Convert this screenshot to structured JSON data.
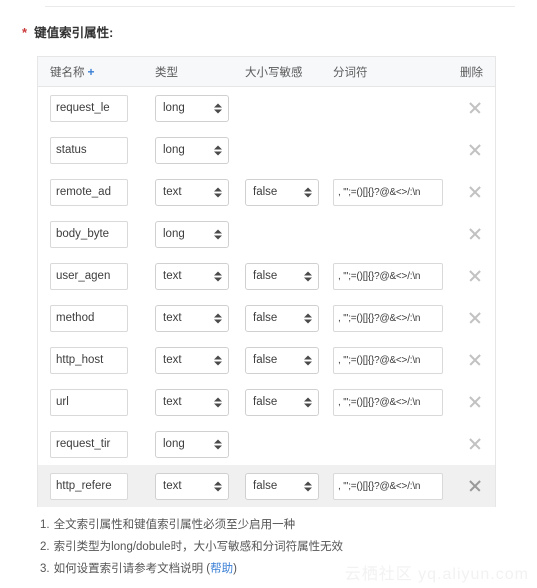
{
  "section": {
    "label": "键值索引属性:",
    "required_marker": "*"
  },
  "table": {
    "headers": {
      "key_name": "键名称",
      "add_symbol": "+",
      "type": "类型",
      "case_sensitive": "大小写敏感",
      "tokenizer": "分词符",
      "delete": "删除"
    },
    "delete_icon": "close-icon",
    "rows": [
      {
        "key": "request_le",
        "type": "long",
        "case": "",
        "tokenizer": "",
        "hovered": false
      },
      {
        "key": "status",
        "type": "long",
        "case": "",
        "tokenizer": "",
        "hovered": false
      },
      {
        "key": "remote_ad",
        "type": "text",
        "case": "false",
        "tokenizer": ", '\";=()[]{}?@&<>/:\\n",
        "hovered": false
      },
      {
        "key": "body_byte",
        "type": "long",
        "case": "",
        "tokenizer": "",
        "hovered": false
      },
      {
        "key": "user_agen",
        "type": "text",
        "case": "false",
        "tokenizer": ", '\";=()[]{}?@&<>/:\\n",
        "hovered": false
      },
      {
        "key": "method",
        "type": "text",
        "case": "false",
        "tokenizer": ", '\";=()[]{}?@&<>/:\\n",
        "hovered": false
      },
      {
        "key": "http_host",
        "type": "text",
        "case": "false",
        "tokenizer": ", '\";=()[]{}?@&<>/:\\n",
        "hovered": false
      },
      {
        "key": "url",
        "type": "text",
        "case": "false",
        "tokenizer": ", '\";=()[]{}?@&<>/:\\n",
        "hovered": false
      },
      {
        "key": "request_tir",
        "type": "long",
        "case": "",
        "tokenizer": "",
        "hovered": false
      },
      {
        "key": "http_refere",
        "type": "text",
        "case": "false",
        "tokenizer": ", '\";=()[]{}?@&<>/:\\n",
        "hovered": true
      }
    ]
  },
  "notes": [
    {
      "num": "1.",
      "text": "全文索引属性和键值索引属性必须至少启用一种",
      "link": "",
      "tail": ""
    },
    {
      "num": "2.",
      "text": "索引类型为long/dobule时，大小写敏感和分词符属性无效",
      "link": "",
      "tail": ""
    },
    {
      "num": "3.",
      "text": "如何设置索引请参考文档说明",
      "link": "帮助",
      "tail": ""
    }
  ],
  "watermark": "云栖社区 yq.aliyun.com",
  "colors": {
    "accent": "#3a7fd5",
    "required": "#cc3b3b",
    "header_bg": "#f7f8fa",
    "hover_bg": "#f0f0f0"
  }
}
